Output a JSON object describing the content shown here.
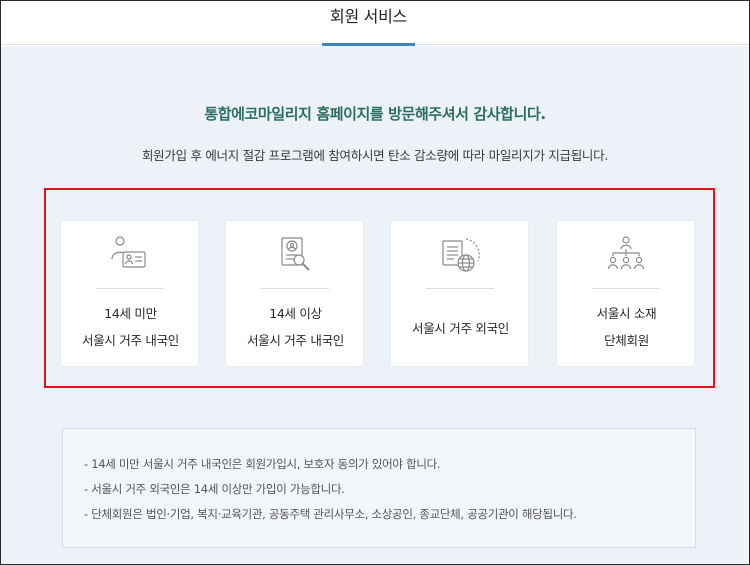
{
  "header": {
    "title": "회원 서비스"
  },
  "main": {
    "welcome": "통합에코마일리지 홈페이지를 방문해주셔서 감사합니다.",
    "subtitle": "회원가입 후 에너지 절감 프로그램에 참여하시면 탄소 감소량에 따라 마일리지가 지급됩니다.",
    "cards": [
      {
        "line1": "14세 미만",
        "line2": "서울시 거주 내국인",
        "icon": "id-card-person-icon"
      },
      {
        "line1": "14세 이상",
        "line2": "서울시 거주 내국인",
        "icon": "document-search-icon"
      },
      {
        "line1": "서울시 거주 외국인",
        "line2": "",
        "icon": "document-globe-icon"
      },
      {
        "line1": "서울시 소재",
        "line2": "단체회원",
        "icon": "group-org-icon"
      }
    ],
    "highlight_color": "#e3131b"
  },
  "notes": {
    "items": [
      "- 14세 미만 서울시 거주 내국인은 회원가입시, 보호자 동의가 있어야 합니다.",
      "- 서울시 거주 외국인은 14세 이상만 가입이 가능합니다.",
      "- 단체회원은 법인·기업, 복지·교육기관, 공동주택 관리사무소, 소상공인, 종교단체, 공공기관이 해당됩니다."
    ]
  }
}
